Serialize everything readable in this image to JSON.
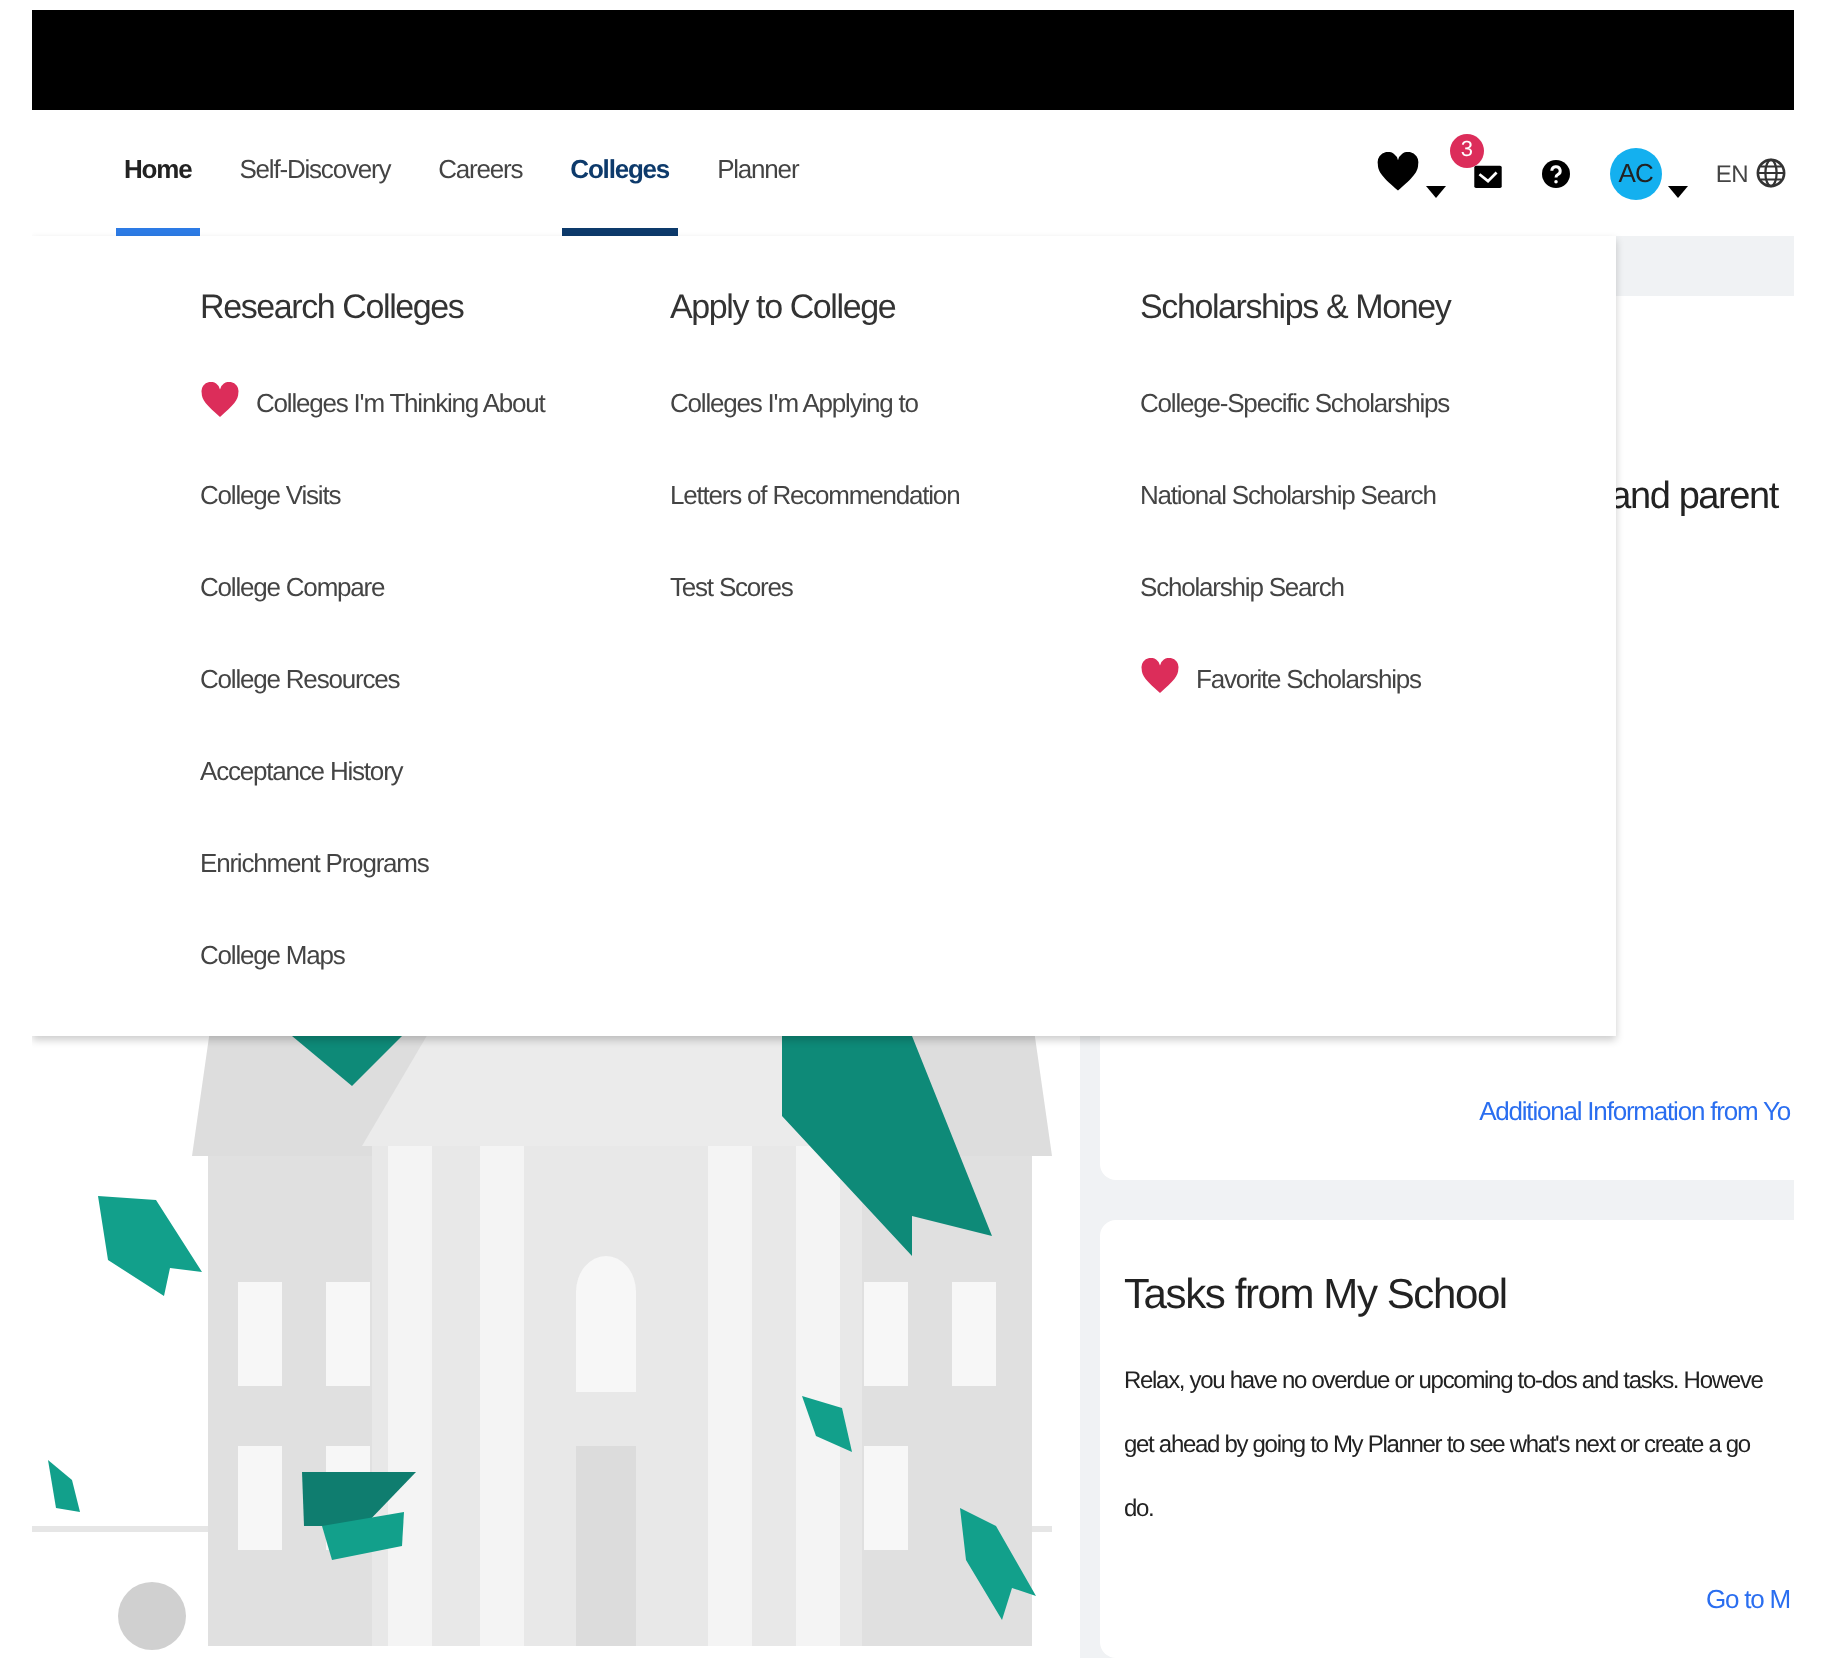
{
  "nav": {
    "tabs": [
      {
        "label": "Home",
        "selected": false,
        "current": true
      },
      {
        "label": "Self-Discovery",
        "selected": false,
        "current": false
      },
      {
        "label": "Careers",
        "selected": false,
        "current": false
      },
      {
        "label": "Colleges",
        "selected": true,
        "current": false
      },
      {
        "label": "Planner",
        "selected": false,
        "current": false
      }
    ],
    "mail_badge": "3",
    "avatar": "AC",
    "language": "EN"
  },
  "dropdown": {
    "columns": [
      {
        "heading": "Research Colleges",
        "items": [
          {
            "label": "Colleges I'm Thinking About",
            "kind": "favorite"
          },
          {
            "label": "College Visits",
            "kind": "link"
          },
          {
            "label": "College Compare",
            "kind": "link"
          },
          {
            "label": "College Resources",
            "kind": "link"
          },
          {
            "label": "Acceptance History",
            "kind": "link"
          },
          {
            "label": "Enrichment Programs",
            "kind": "link"
          },
          {
            "label": "College Maps",
            "kind": "link"
          }
        ]
      },
      {
        "heading": "Apply to College",
        "items": [
          {
            "label": "Colleges I'm Applying to",
            "kind": "link"
          },
          {
            "label": "Letters of Recommendation",
            "kind": "link"
          },
          {
            "label": "Test Scores",
            "kind": "link"
          }
        ]
      },
      {
        "heading": "Scholarships & Money",
        "items": [
          {
            "label": "College-Specific Scholarships",
            "kind": "link"
          },
          {
            "label": "National Scholarship Search",
            "kind": "link"
          },
          {
            "label": "Scholarship Search",
            "kind": "link"
          },
          {
            "label": "Favorite Scholarships",
            "kind": "favorite"
          }
        ]
      }
    ]
  },
  "info_card": {
    "text": "and parent",
    "link": "Additional Information from Yo"
  },
  "tasks_card": {
    "title": "Tasks from My School",
    "lines": [
      "Relax, you have no overdue or upcoming to-dos and tasks. Howeve",
      "get ahead by going to My Planner to see what's next or create a go",
      "do."
    ],
    "link": "Go to M"
  }
}
